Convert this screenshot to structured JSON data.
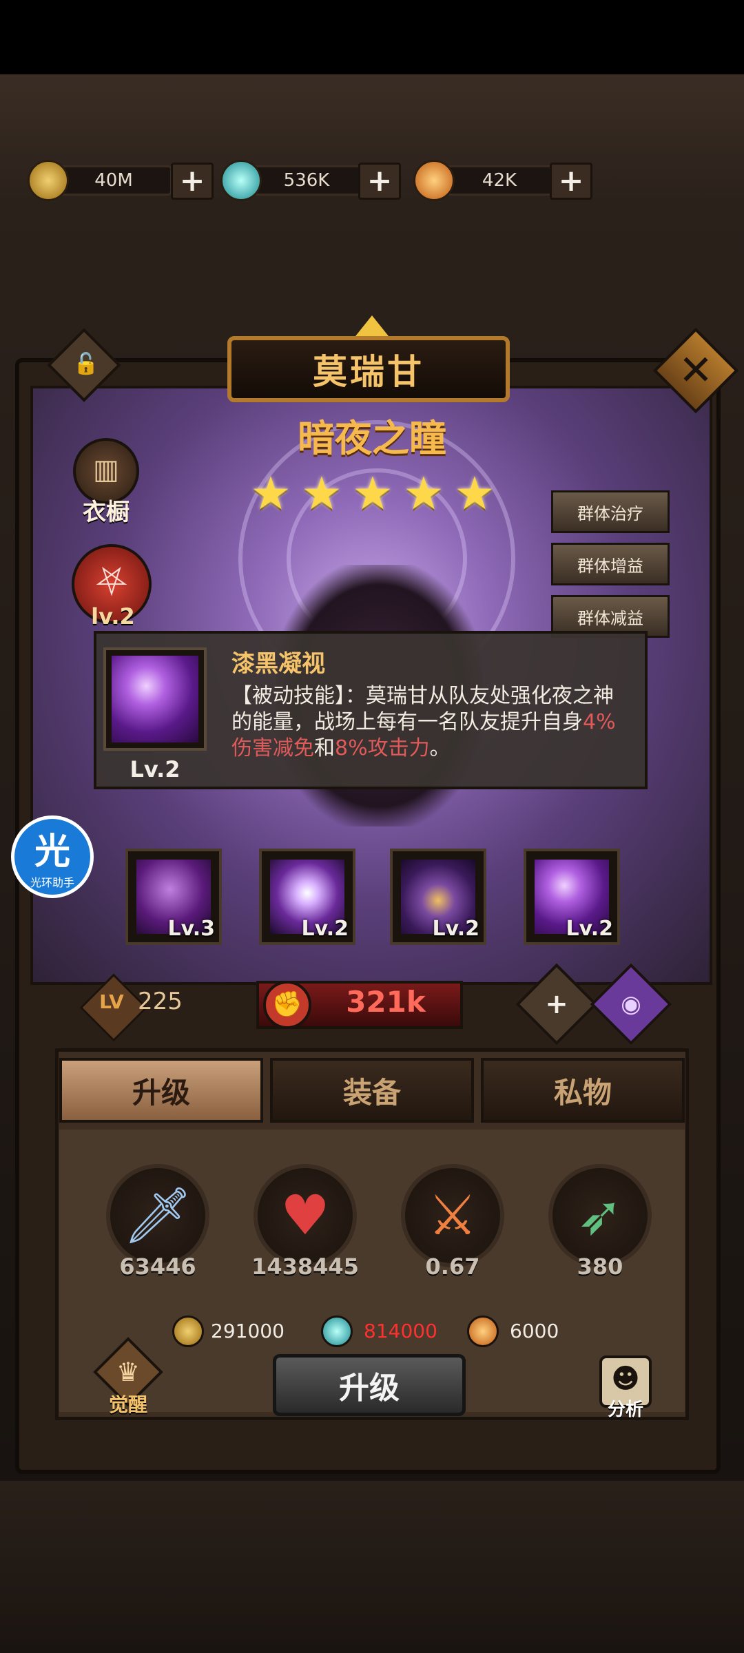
{
  "currencies": [
    {
      "name": "gold",
      "icon": "gold-coin-icon",
      "value": "40M",
      "color": "#e0b040"
    },
    {
      "name": "crystal",
      "icon": "crystal-orb-icon",
      "value": "536K",
      "color": "#40c8c8"
    },
    {
      "name": "energy",
      "icon": "energy-orb-icon",
      "value": "42K",
      "color": "#f0a030"
    }
  ],
  "currency_plus": "+",
  "hero": {
    "name": "莫瑞甘",
    "title": "暗夜之瞳",
    "stars": 5,
    "star_glyph": "★",
    "tags": [
      "群体治疗",
      "群体增益",
      "群体减益"
    ]
  },
  "side": {
    "wardrobe_label": "衣橱",
    "rune_label": "lv.2",
    "lock_glyph": "🔓",
    "close_glyph": "✕"
  },
  "skill_tooltip": {
    "title": "漆黑凝视",
    "level": "Lv.2",
    "desc_main": "【被动技能】：莫瑞甘从队友处强化夜之神的能量，战场上每有一名队友提升自身",
    "desc_val1": "4%伤害减免",
    "desc_and": "和",
    "desc_val2": "8%攻击力",
    "desc_end": "。"
  },
  "skills": [
    {
      "level": "Lv.3",
      "icon": "dark-beast-skill-icon"
    },
    {
      "level": "Lv.2",
      "icon": "eye-orb-skill-icon"
    },
    {
      "level": "Lv.2",
      "icon": "hooded-mage-skill-icon"
    },
    {
      "level": "Lv.2",
      "icon": "dark-gaze-skill-icon"
    }
  ],
  "assistant": {
    "char": "光",
    "label": "光环助手"
  },
  "level": {
    "label": "LV",
    "value": "225"
  },
  "power": {
    "value": "321k"
  },
  "tabs": [
    {
      "label": "升级",
      "active": true
    },
    {
      "label": "装备",
      "active": false
    },
    {
      "label": "私物",
      "active": false
    }
  ],
  "stats": [
    {
      "name": "attack",
      "icon": "sword-icon",
      "value": "63446"
    },
    {
      "name": "hp",
      "icon": "heart-icon",
      "value": "1438445"
    },
    {
      "name": "crit",
      "icon": "slash-icon",
      "value": "0.67"
    },
    {
      "name": "speed",
      "icon": "arrow-icon",
      "value": "380"
    }
  ],
  "costs": [
    {
      "icon": "gold-coin-icon",
      "value": "291000",
      "color": "#f0ece4"
    },
    {
      "icon": "crystal-orb-icon",
      "value": "814000",
      "color": "#ff3030"
    },
    {
      "icon": "energy-orb-icon",
      "value": "6000",
      "color": "#f0ece4"
    }
  ],
  "upgrade_label": "升级",
  "awaken_label": "觉醒",
  "analyze_label": "分析"
}
